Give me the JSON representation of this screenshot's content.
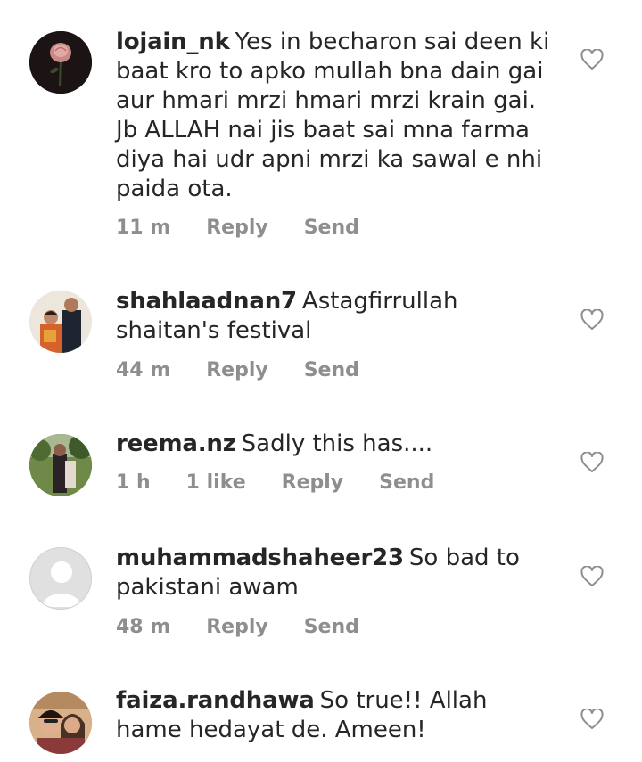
{
  "comments": [
    {
      "username": "lojain_nk",
      "text": "Yes in becharon sai deen ki baat kro to apko mullah bna dain gai aur hmari mrzi hmari mrzi krain gai. Jb ALLAH nai jis baat sai mna farma diya hai udr apni mrzi ka sawal e nhi paida ota.",
      "time": "11 m",
      "reply_label": "Reply",
      "send_label": "Send",
      "avatar": "rose-photo"
    },
    {
      "username": "shahlaadnan7",
      "text": "Astagfirrullah shaitan's festival",
      "time": "44 m",
      "reply_label": "Reply",
      "send_label": "Send",
      "avatar": "couple-photo"
    },
    {
      "username": "reema.nz",
      "text": "Sadly this has....",
      "time": "1 h",
      "likes": "1 like",
      "reply_label": "Reply",
      "send_label": "Send",
      "avatar": "outdoor-photo"
    },
    {
      "username": "muhammadshaheer23",
      "text": "So bad to pakistani awam",
      "time": "48 m",
      "reply_label": "Reply",
      "send_label": "Send",
      "avatar": "default-avatar"
    },
    {
      "username": "faiza.randhawa",
      "text": "So true!! Allah hame hedayat de. Ameen!",
      "avatar": "selfie-photo"
    }
  ],
  "icons": {
    "like": "heart-outline-icon"
  },
  "colors": {
    "text": "#262626",
    "meta": "#8e8e8e",
    "heart": "#8e8e8e"
  }
}
